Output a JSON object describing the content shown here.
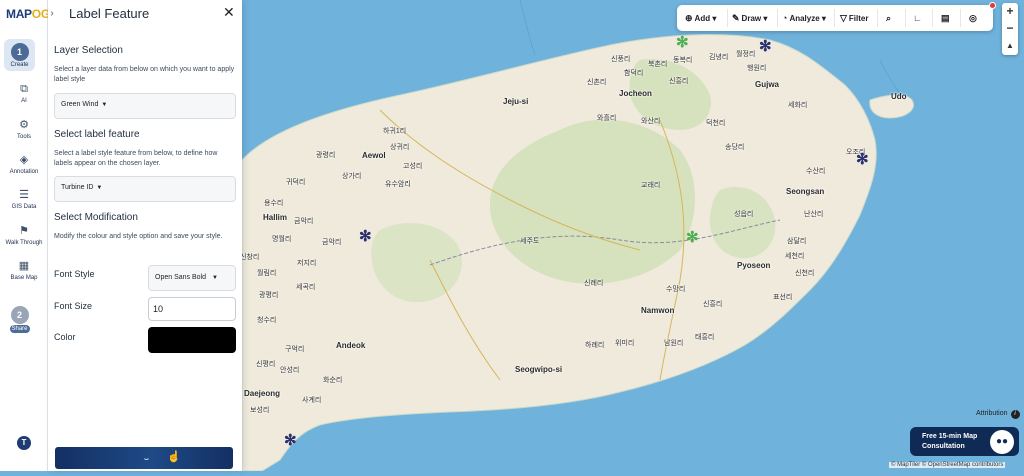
{
  "app": {
    "logo_main": "MAP",
    "logo_accent": "OG"
  },
  "sidebar": {
    "steps": [
      {
        "num": "1",
        "label": "Create"
      },
      {
        "num": "2",
        "label": "Share"
      }
    ],
    "items": [
      {
        "icon": "ai-icon",
        "label": "AI"
      },
      {
        "icon": "tools-icon",
        "label": "Tools"
      },
      {
        "icon": "annotation-icon",
        "label": "Annotation"
      },
      {
        "icon": "gis-data-icon",
        "label": "GIS Data"
      },
      {
        "icon": "walk-through-icon",
        "label": "Walk Through"
      },
      {
        "icon": "base-map-icon",
        "label": "Base Map"
      }
    ],
    "avatar_initial": "T"
  },
  "panel": {
    "title": "Label Feature",
    "layer_section": {
      "heading": "Layer Selection",
      "description": "Select a layer data from below on which you want to apply label style",
      "selected": "Green Wind"
    },
    "label_section": {
      "heading": "Select label feature",
      "description": "Select a label style feature from below, to define how labels appear on the chosen layer.",
      "selected": "Turbine ID"
    },
    "modification_section": {
      "heading": "Select Modification",
      "description": "Modify the colour and style option and save your style.",
      "font_style_label": "Font Style",
      "font_style_value": "Open Sans Bold",
      "font_size_label": "Font Size",
      "font_size_value": "10",
      "color_label": "Color",
      "color_value": "#000000"
    }
  },
  "toolbar": {
    "add": "Add",
    "draw": "Draw",
    "analyze": "Analyze",
    "filter": "Filter"
  },
  "map": {
    "labels": [
      {
        "text": "Jeju-si",
        "size": "big"
      },
      {
        "text": "Aewol",
        "size": "big"
      },
      {
        "text": "Hallim",
        "size": "big"
      },
      {
        "text": "Jocheon",
        "size": "big"
      },
      {
        "text": "Gujwa",
        "size": "big"
      },
      {
        "text": "Udo",
        "size": "big"
      },
      {
        "text": "Seongsan",
        "size": "big"
      },
      {
        "text": "Pyoseon",
        "size": "big"
      },
      {
        "text": "Namwon",
        "size": "big"
      },
      {
        "text": "Andeok",
        "size": "big"
      },
      {
        "text": "Seogwipo-si",
        "size": "big"
      },
      {
        "text": "Daejeong",
        "size": "big"
      },
      {
        "text": "신풍리",
        "size": "small"
      },
      {
        "text": "북촌리",
        "size": "small"
      },
      {
        "text": "동복리",
        "size": "small"
      },
      {
        "text": "김녕리",
        "size": "small"
      },
      {
        "text": "월정리",
        "size": "small"
      },
      {
        "text": "함덕리",
        "size": "small"
      },
      {
        "text": "행원리",
        "size": "small"
      },
      {
        "text": "신촌리",
        "size": "small"
      },
      {
        "text": "신흥리",
        "size": "small"
      },
      {
        "text": "세화리",
        "size": "small"
      },
      {
        "text": "와흘리",
        "size": "small"
      },
      {
        "text": "와산리",
        "size": "small"
      },
      {
        "text": "덕천리",
        "size": "small"
      },
      {
        "text": "송당리",
        "size": "small"
      },
      {
        "text": "하귀1리",
        "size": "small"
      },
      {
        "text": "상귀리",
        "size": "small"
      },
      {
        "text": "오조리",
        "size": "small"
      },
      {
        "text": "수산리",
        "size": "small"
      },
      {
        "text": "광령리",
        "size": "small"
      },
      {
        "text": "고성리",
        "size": "small"
      },
      {
        "text": "교래리",
        "size": "small"
      },
      {
        "text": "유수암리",
        "size": "small"
      },
      {
        "text": "상가리",
        "size": "small"
      },
      {
        "text": "귀덕리",
        "size": "small"
      },
      {
        "text": "난산리",
        "size": "small"
      },
      {
        "text": "성읍리",
        "size": "small"
      },
      {
        "text": "금악리",
        "size": "small"
      },
      {
        "text": "명월리",
        "size": "small"
      },
      {
        "text": "금악리",
        "size": "small"
      },
      {
        "text": "삼달리",
        "size": "small"
      },
      {
        "text": "세천리",
        "size": "small"
      },
      {
        "text": "월림리",
        "size": "small"
      },
      {
        "text": "저지리",
        "size": "small"
      },
      {
        "text": "신천리",
        "size": "small"
      },
      {
        "text": "청수리",
        "size": "small"
      },
      {
        "text": "신례리",
        "size": "small"
      },
      {
        "text": "수망리",
        "size": "small"
      },
      {
        "text": "신흥리",
        "size": "small"
      },
      {
        "text": "표선리",
        "size": "small"
      },
      {
        "text": "구억리",
        "size": "small"
      },
      {
        "text": "하례리",
        "size": "small"
      },
      {
        "text": "위미리",
        "size": "small"
      },
      {
        "text": "남원리",
        "size": "small"
      },
      {
        "text": "태흥리",
        "size": "small"
      },
      {
        "text": "신평리",
        "size": "small"
      },
      {
        "text": "안성리",
        "size": "small"
      },
      {
        "text": "화순리",
        "size": "small"
      },
      {
        "text": "사계리",
        "size": "small"
      },
      {
        "text": "보성리",
        "size": "small"
      },
      {
        "text": "세곡리",
        "size": "small"
      },
      {
        "text": "광평리",
        "size": "small"
      },
      {
        "text": "세주도",
        "size": "small"
      },
      {
        "text": "용수리",
        "size": "small"
      },
      {
        "text": "신창리",
        "size": "small"
      }
    ],
    "turbines": [
      {
        "color": "#4caf50"
      },
      {
        "color": "#2a3070"
      },
      {
        "color": "#2a3070"
      },
      {
        "color": "#2a3070"
      },
      {
        "color": "#4caf50"
      },
      {
        "color": "#2a3070"
      }
    ],
    "attribution_label": "Attribution",
    "consult_line1": "Free 15-min Map",
    "consult_line2": "Consultation",
    "credits": "© MapTiler © OpenStreetMap contributors"
  }
}
